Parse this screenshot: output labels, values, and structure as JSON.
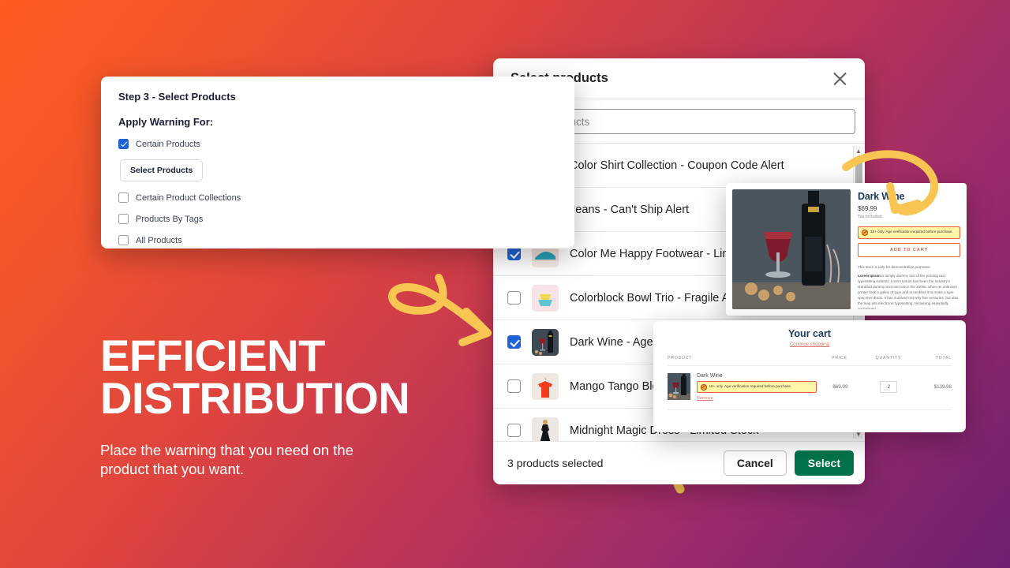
{
  "theme": {
    "bg_gradient_start": "#ff5a1f",
    "bg_gradient_end": "#6e1f70",
    "accent_arrow": "#f9c552",
    "checkbox_blue": "#1f63d6",
    "select_green": "#00734a",
    "warning_bg": "#fff7a8",
    "warning_border": "#e2603f"
  },
  "hero": {
    "title_line1": "EFFICIENT",
    "title_line2": "DISTRIBUTION",
    "subtitle": "Place the warning that you need on the product that you want."
  },
  "step_card": {
    "title": "Step 3 - Select Products",
    "subtitle": "Apply Warning For:",
    "select_products_button": "Select Products",
    "options": [
      {
        "label": "Certain Products",
        "checked": true
      },
      {
        "label": "Certain Product Collections",
        "checked": false
      },
      {
        "label": "Products By Tags",
        "checked": false
      },
      {
        "label": "All Products",
        "checked": false
      }
    ]
  },
  "products_modal": {
    "title": "Select products",
    "close_icon": "close-icon",
    "search_placeholder": "Search products",
    "search_value": "",
    "products": [
      {
        "name": "Color Shirt Collection - Coupon Code Alert",
        "checked": false,
        "thumb": "shirt"
      },
      {
        "name": "Jeans - Can't Ship Alert",
        "checked": false,
        "thumb": "jeans"
      },
      {
        "name": "Color Me Happy Footwear - Limited Stock",
        "checked": true,
        "thumb": "shoes"
      },
      {
        "name": "Colorblock Bowl Trio - Fragile Alert",
        "checked": false,
        "thumb": "bowls"
      },
      {
        "name": "Dark Wine - Age Restriction Alert",
        "checked": true,
        "thumb": "wine"
      },
      {
        "name": "Mango Tango Blouse - Shipping Alert",
        "checked": false,
        "thumb": "blouse"
      },
      {
        "name": "Midnight Magic Dress - Limited Stock",
        "checked": false,
        "thumb": "dress"
      }
    ],
    "footer_count": "3 products selected",
    "cancel_label": "Cancel",
    "select_label": "Select"
  },
  "product_detail": {
    "name": "Dark Wine",
    "price": "$69.99",
    "tax_note": "Tax included.",
    "warning": "18+ only. Age verification required before purchase.",
    "add_to_cart": "ADD TO CART",
    "store_note": "This store is only for demonstrative purposes.",
    "lorem_lead": "Lorem Ipsum",
    "lorem_body": " is simply dummy text of the printing and typesetting industry. Lorem Ipsum has been the industry's standard dummy text ever since the 1500s, when an unknown printer took a galley of type and scrambled it to make a type specimen book. It has survived not only five centuries, but also the leap into electronic typesetting, remaining essentially unchanged."
  },
  "cart": {
    "title": "Your cart",
    "continue_link": "Continue shopping",
    "columns": {
      "product": "PRODUCT",
      "price": "PRICE",
      "quantity": "QUANTITY",
      "total": "TOTAL"
    },
    "row": {
      "name": "Dark Wine",
      "warning": "18+ only. Age verification required before purchase.",
      "remove_label": "Remove",
      "price": "$69.99",
      "quantity": "2",
      "total": "$139.98"
    }
  },
  "annotations": {
    "arrow_to_modal": "curly-arrow-right-icon",
    "arrow_to_product": "curly-arrow-down-icon",
    "arrow_to_cart": "curly-arrow-up-icon"
  }
}
